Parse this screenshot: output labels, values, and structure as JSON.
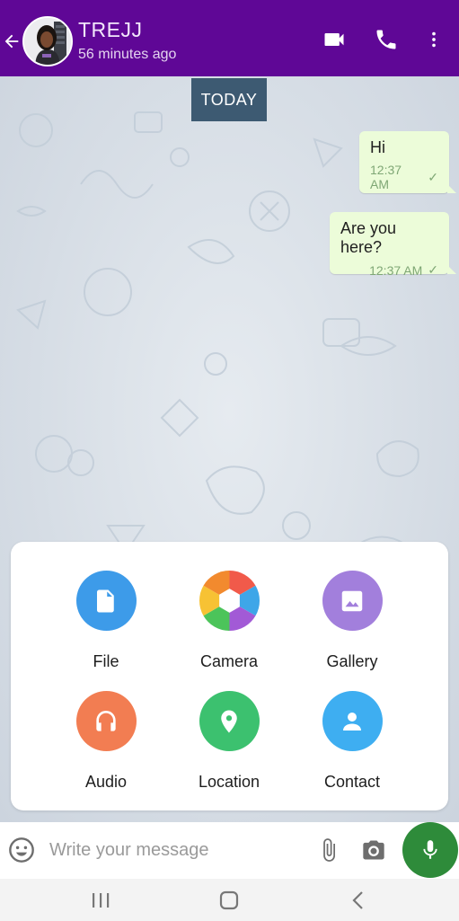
{
  "header": {
    "contact_name": "TREJJ",
    "last_seen": "56 minutes ago",
    "icons": [
      "back-arrow-icon",
      "video-call-icon",
      "phone-icon",
      "more-vertical-icon"
    ],
    "bar_color": "#5f0796"
  },
  "chat": {
    "date_label": "TODAY",
    "messages": [
      {
        "text": "Hi",
        "time": "12:37 AM",
        "status": "sent",
        "check": "✓"
      },
      {
        "text": "Are you here?",
        "time": "12:37 AM",
        "status": "sent",
        "check": "✓"
      }
    ]
  },
  "attach_menu": {
    "items": [
      {
        "label": "File",
        "icon": "file-icon",
        "color": "#3d9be9"
      },
      {
        "label": "Camera",
        "icon": "camera-aperture-icon",
        "color": "#ffffff"
      },
      {
        "label": "Gallery",
        "icon": "image-icon",
        "color": "#a27fdc"
      },
      {
        "label": "Audio",
        "icon": "headphones-icon",
        "color": "#f27d52"
      },
      {
        "label": "Location",
        "icon": "location-pin-icon",
        "color": "#3cc16f"
      },
      {
        "label": "Contact",
        "icon": "person-icon",
        "color": "#3eaef1"
      }
    ]
  },
  "composer": {
    "placeholder": "Write your message",
    "value": "",
    "send_button_color": "#2e8b3a"
  },
  "system_nav": {
    "icons": [
      "recent-apps-icon",
      "home-icon",
      "back-icon"
    ]
  }
}
